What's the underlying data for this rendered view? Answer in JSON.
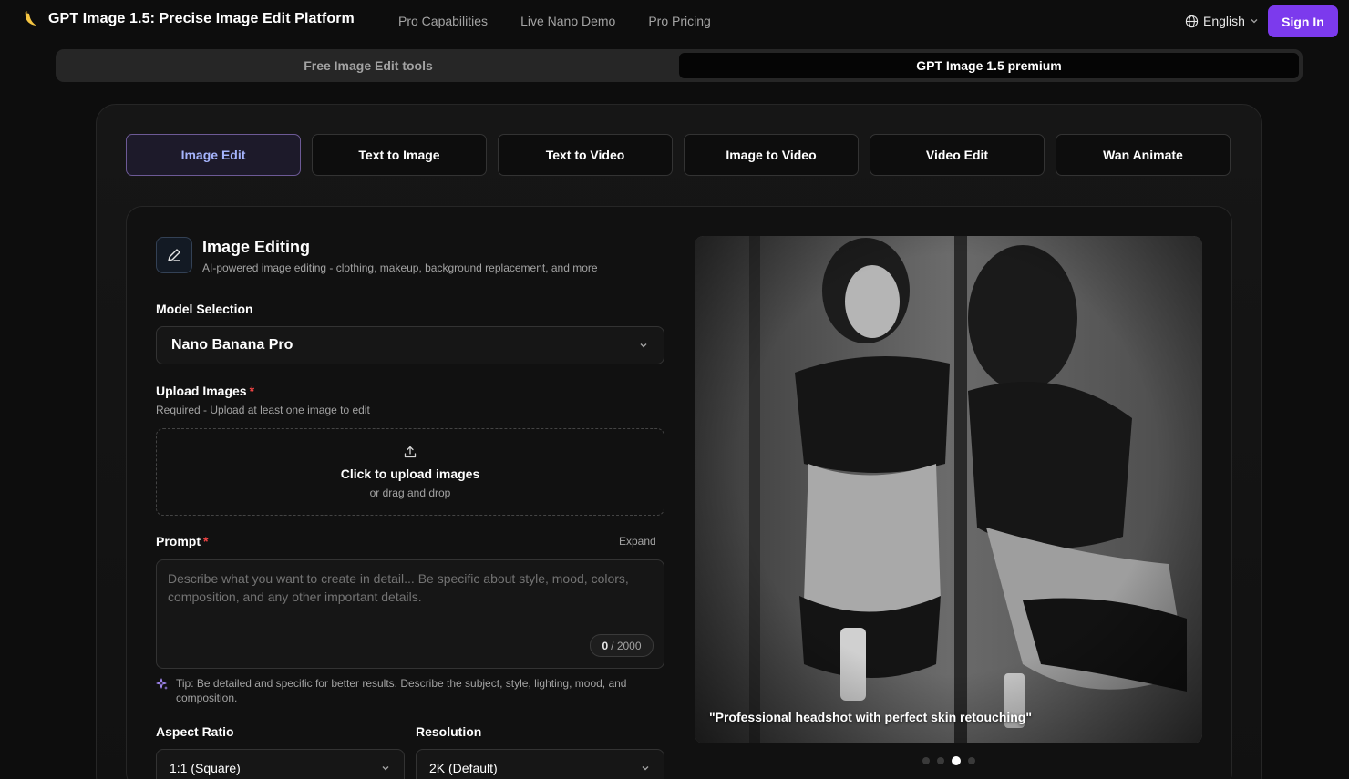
{
  "header": {
    "title": "GPT Image 1.5: Precise Image Edit Platform",
    "nav": [
      "Pro Capabilities",
      "Live Nano Demo",
      "Pro Pricing"
    ],
    "language": "English",
    "sign_in": "Sign In"
  },
  "modes": {
    "free": "Free Image Edit tools",
    "premium": "GPT Image 1.5 premium"
  },
  "tabs": [
    "Image Edit",
    "Text to Image",
    "Text to Video",
    "Image to Video",
    "Video Edit",
    "Wan Animate"
  ],
  "editor": {
    "title": "Image Editing",
    "subtitle": "AI-powered image editing - clothing, makeup, background replacement, and more",
    "model_label": "Model Selection",
    "model_value": "Nano Banana Pro",
    "upload_label": "Upload Images",
    "upload_hint": "Required - Upload at least one image to edit",
    "upload_main": "Click to upload images",
    "upload_sub": "or drag and drop",
    "prompt_label": "Prompt",
    "expand": "Expand",
    "prompt_placeholder": "Describe what you want to create in detail... Be specific about style, mood, colors, composition, and any other important details.",
    "counter_current": "0",
    "counter_max": "/ 2000",
    "tip": "Tip: Be detailed and specific for better results. Describe the subject, style, lighting, mood, and composition.",
    "aspect_label": "Aspect Ratio",
    "aspect_value": "1:1 (Square)",
    "resolution_label": "Resolution",
    "resolution_value": "2K (Default)"
  },
  "preview": {
    "caption": "\"Professional headshot with perfect skin retouching\"",
    "active_slide": 3,
    "slide_count": 4
  },
  "colors": {
    "accent": "#7c3aed",
    "active_tab_text": "#a5b4fc",
    "required": "#ef4444"
  }
}
